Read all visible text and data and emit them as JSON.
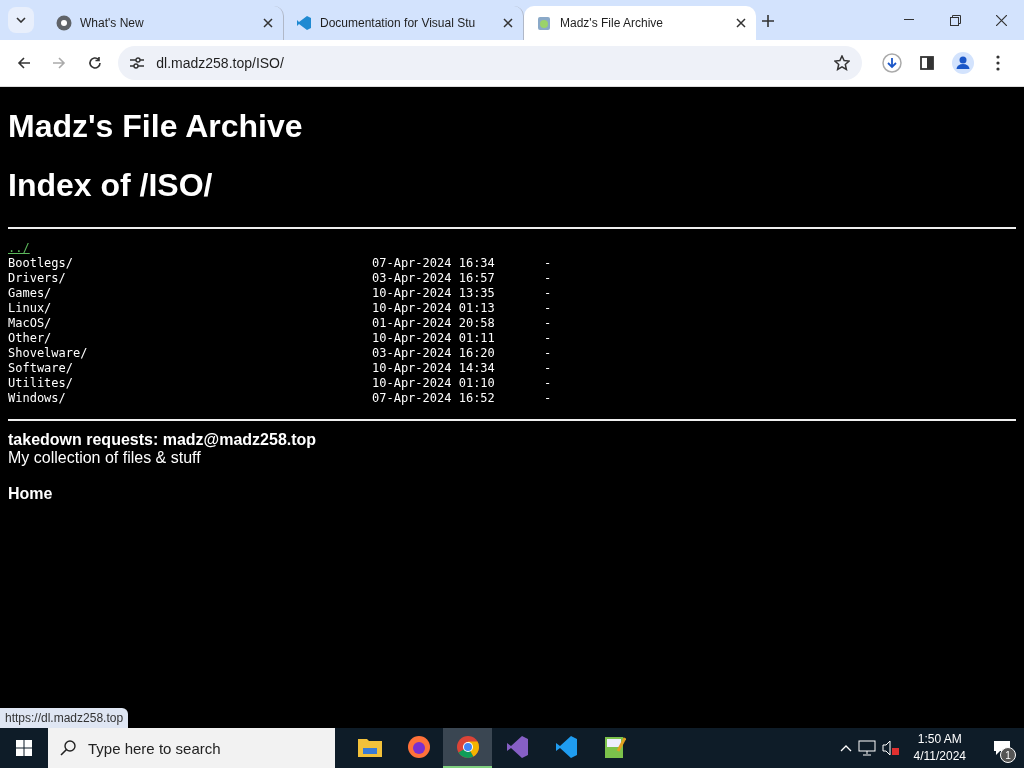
{
  "browser": {
    "tabs": [
      {
        "title": "What's New",
        "selected": false
      },
      {
        "title": "Documentation for Visual Stu",
        "selected": false
      },
      {
        "title": "Madz's File Archive",
        "selected": true
      }
    ],
    "address": "dl.madz258.top/ISO/",
    "status_url": "https://dl.madz258.top"
  },
  "page": {
    "title": "Madz's File Archive",
    "heading": "Index of /ISO/",
    "parent_link": "../",
    "rows": [
      {
        "name": "Bootlegs/",
        "date": "07-Apr-2024 16:34",
        "size": "-"
      },
      {
        "name": "Drivers/",
        "date": "03-Apr-2024 16:57",
        "size": "-"
      },
      {
        "name": "Games/",
        "date": "10-Apr-2024 13:35",
        "size": "-"
      },
      {
        "name": "Linux/",
        "date": "10-Apr-2024 01:13",
        "size": "-"
      },
      {
        "name": "MacOS/",
        "date": "01-Apr-2024 20:58",
        "size": "-"
      },
      {
        "name": "Other/",
        "date": "10-Apr-2024 01:11",
        "size": "-"
      },
      {
        "name": "Shovelware/",
        "date": "03-Apr-2024 16:20",
        "size": "-"
      },
      {
        "name": "Software/",
        "date": "10-Apr-2024 14:34",
        "size": "-"
      },
      {
        "name": "Utilites/",
        "date": "10-Apr-2024 01:10",
        "size": "-"
      },
      {
        "name": "Windows/",
        "date": "07-Apr-2024 16:52",
        "size": "-"
      }
    ],
    "takedown": "takedown requests: madz@madz258.top",
    "description": "My collection of files & stuff",
    "home_link": "Home"
  },
  "taskbar": {
    "search_placeholder": "Type here to search",
    "apps": [
      {
        "selected": false
      },
      {
        "selected": false
      },
      {
        "selected": true
      },
      {
        "selected": false
      },
      {
        "selected": false
      },
      {
        "selected": false
      }
    ],
    "time": "1:50 AM",
    "date": "4/11/2024",
    "notification_count": "1"
  }
}
